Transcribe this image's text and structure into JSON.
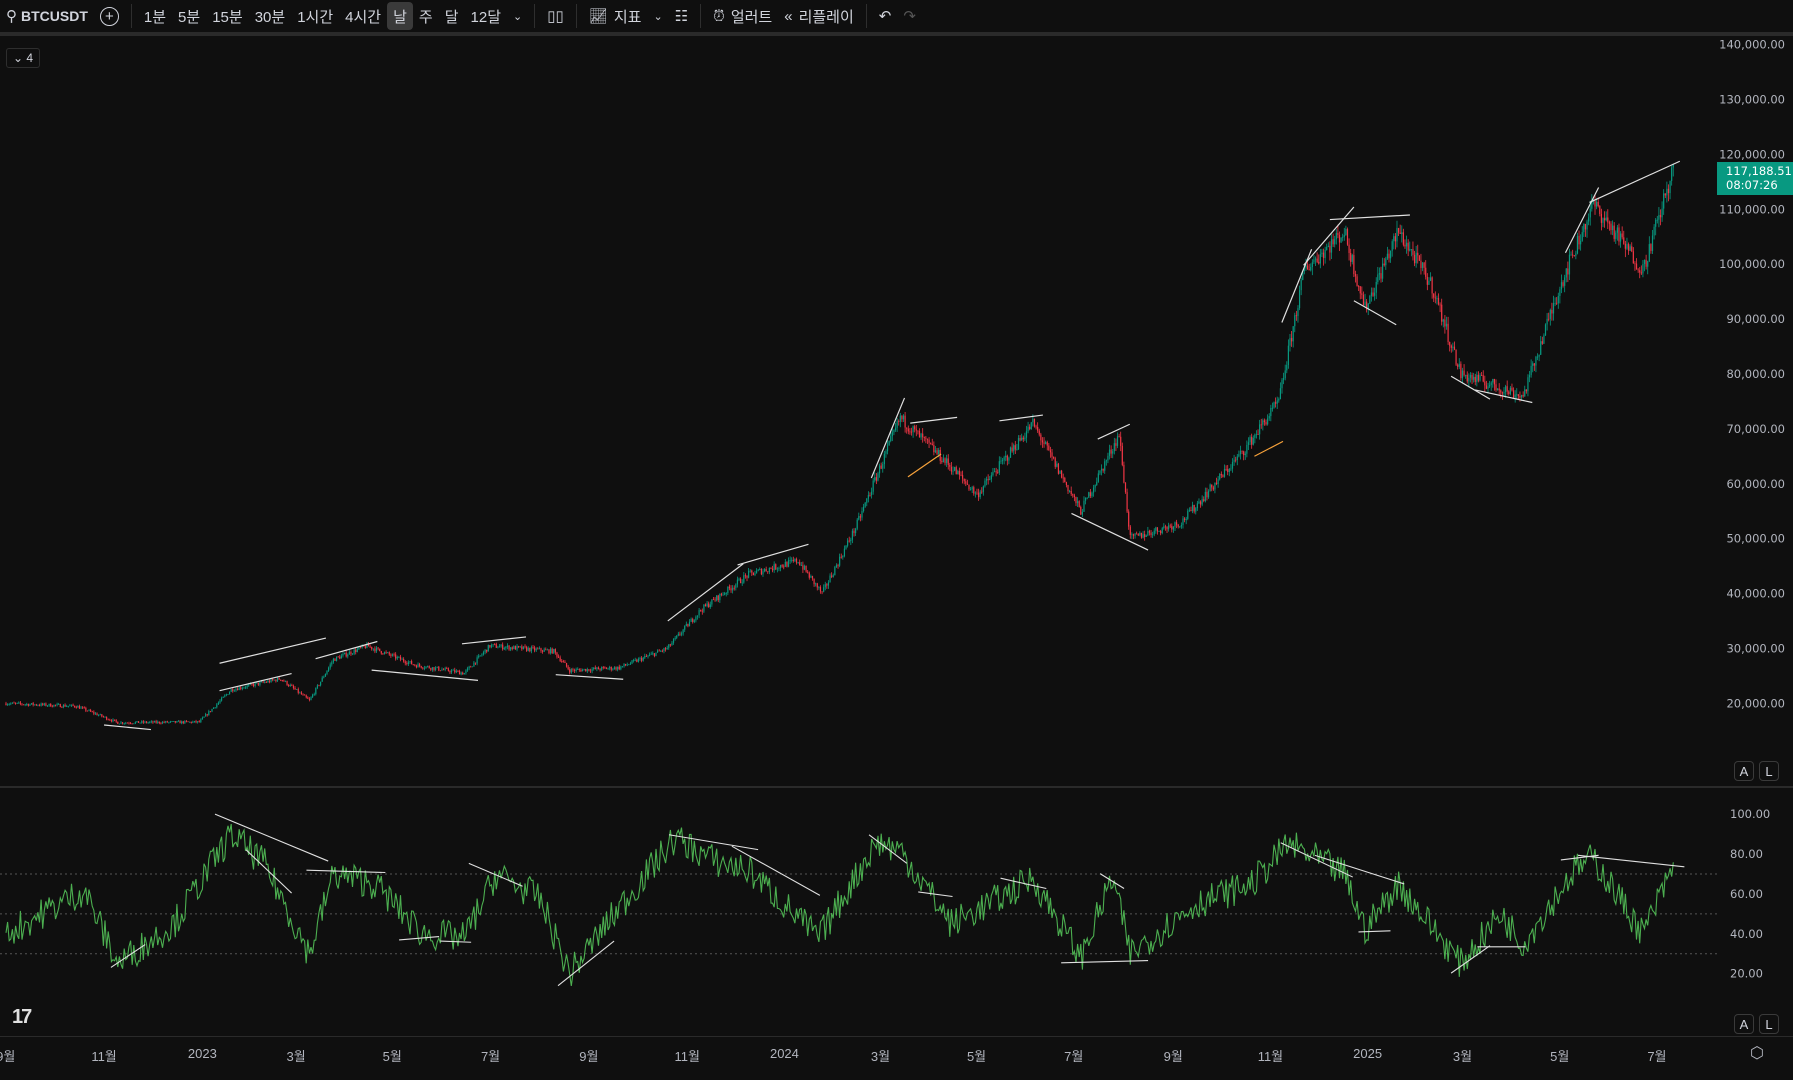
{
  "toolbar": {
    "symbol": "BTCUSDT",
    "intervals": [
      "1분",
      "5분",
      "15분",
      "30분",
      "1시간",
      "4시간",
      "날",
      "주",
      "달",
      "12달"
    ],
    "active_interval": "날",
    "indicators_label": "지표",
    "alert_label": "얼러트",
    "replay_label": "리플레이"
  },
  "legend_toggle": "4",
  "price_axis": {
    "labels": [
      "140,000.00",
      "130,000.00",
      "120,000.00",
      "110,000.00",
      "100,000.00",
      "90,000.00",
      "80,000.00",
      "70,000.00",
      "60,000.00",
      "50,000.00",
      "40,000.00",
      "30,000.00",
      "20,000.00"
    ]
  },
  "last_price": {
    "value": "117,188.51",
    "countdown": "08:07:26",
    "color": "#089981"
  },
  "rsi_axis": {
    "labels": [
      "100.00",
      "80.00",
      "60.00",
      "40.00",
      "20.00"
    ]
  },
  "time_axis": [
    "9월",
    "11월",
    "2023",
    "3월",
    "5월",
    "7월",
    "9월",
    "11월",
    "2024",
    "3월",
    "5월",
    "7월",
    "9월",
    "11월",
    "2025",
    "3월",
    "5월",
    "7월"
  ],
  "scale_buttons": {
    "auto": "A",
    "log": "L"
  },
  "colors": {
    "up": "#089981",
    "down": "#f23645",
    "rsi": "#4caf50",
    "trendline": "#e0e0e0"
  },
  "chart_data": [
    {
      "type": "candlestick",
      "symbol": "BTCUSDT",
      "interval": "daily",
      "ylim": [
        10000,
        140000
      ],
      "closes": [
        [
          "2022-09-01",
          20000
        ],
        [
          "2022-10-15",
          19500
        ],
        [
          "2022-11-10",
          16500
        ],
        [
          "2022-12-31",
          16600
        ],
        [
          "2023-01-20",
          22500
        ],
        [
          "2023-02-20",
          24500
        ],
        [
          "2023-03-10",
          20500
        ],
        [
          "2023-03-25",
          28000
        ],
        [
          "2023-04-15",
          30500
        ],
        [
          "2023-05-15",
          27000
        ],
        [
          "2023-06-15",
          25500
        ],
        [
          "2023-07-01",
          30500
        ],
        [
          "2023-08-10",
          29500
        ],
        [
          "2023-08-20",
          26000
        ],
        [
          "2023-09-20",
          26500
        ],
        [
          "2023-10-20",
          30000
        ],
        [
          "2023-11-10",
          37000
        ],
        [
          "2023-12-10",
          43500
        ],
        [
          "2024-01-10",
          46000
        ],
        [
          "2024-01-25",
          40000
        ],
        [
          "2024-02-15",
          52000
        ],
        [
          "2024-03-14",
          72000
        ],
        [
          "2024-04-15",
          63000
        ],
        [
          "2024-05-01",
          58000
        ],
        [
          "2024-06-05",
          71000
        ],
        [
          "2024-07-05",
          55000
        ],
        [
          "2024-07-29",
          69000
        ],
        [
          "2024-08-05",
          50000
        ],
        [
          "2024-09-06",
          53000
        ],
        [
          "2024-10-15",
          66000
        ],
        [
          "2024-11-06",
          75000
        ],
        [
          "2024-11-22",
          99000
        ],
        [
          "2024-12-17",
          106000
        ],
        [
          "2024-12-30",
          92000
        ],
        [
          "2025-01-20",
          106000
        ],
        [
          "2025-02-10",
          96000
        ],
        [
          "2025-02-28",
          80000
        ],
        [
          "2025-04-08",
          76000
        ],
        [
          "2025-05-01",
          96000
        ],
        [
          "2025-05-22",
          111000
        ],
        [
          "2025-06-22",
          99000
        ],
        [
          "2025-07-11",
          117188
        ]
      ]
    },
    {
      "type": "line",
      "name": "RSI",
      "ylim": [
        0,
        110
      ],
      "levels": [
        70,
        50,
        30
      ],
      "values": [
        [
          "2022-09-01",
          40
        ],
        [
          "2022-10-20",
          62
        ],
        [
          "2022-11-10",
          25
        ],
        [
          "2022-12-15",
          45
        ],
        [
          "2023-01-20",
          90
        ],
        [
          "2023-02-10",
          75
        ],
        [
          "2023-03-10",
          30
        ],
        [
          "2023-03-25",
          70
        ],
        [
          "2023-04-20",
          65
        ],
        [
          "2023-05-20",
          40
        ],
        [
          "2023-06-15",
          38
        ],
        [
          "2023-07-05",
          70
        ],
        [
          "2023-08-01",
          58
        ],
        [
          "2023-08-20",
          20
        ],
        [
          "2023-09-15",
          48
        ],
        [
          "2023-10-25",
          88
        ],
        [
          "2023-11-20",
          76
        ],
        [
          "2023-12-10",
          72
        ],
        [
          "2024-01-23",
          38
        ],
        [
          "2024-02-28",
          86
        ],
        [
          "2024-03-14",
          82
        ],
        [
          "2024-04-15",
          45
        ],
        [
          "2024-05-20",
          60
        ],
        [
          "2024-06-05",
          68
        ],
        [
          "2024-07-05",
          28
        ],
        [
          "2024-07-25",
          68
        ],
        [
          "2024-08-05",
          30
        ],
        [
          "2024-09-15",
          55
        ],
        [
          "2024-10-20",
          65
        ],
        [
          "2024-11-12",
          85
        ],
        [
          "2024-12-17",
          70
        ],
        [
          "2024-12-30",
          42
        ],
        [
          "2025-01-20",
          65
        ],
        [
          "2025-02-28",
          25
        ],
        [
          "2025-03-25",
          50
        ],
        [
          "2025-04-08",
          35
        ],
        [
          "2025-05-10",
          72
        ],
        [
          "2025-05-22",
          78
        ],
        [
          "2025-06-22",
          40
        ],
        [
          "2025-07-11",
          73
        ]
      ]
    }
  ]
}
